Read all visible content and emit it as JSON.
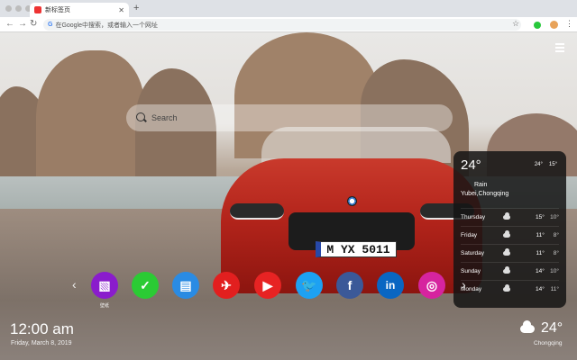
{
  "tab": {
    "title": "新标签页",
    "close_icon": "close-icon",
    "favicon": "app-favicon"
  },
  "omnibox": {
    "placeholder": "在Google中搜索，或者输入一个网址",
    "engine_icon": "G"
  },
  "search": {
    "placeholder": "Search"
  },
  "weather_panel": {
    "temp": "24°",
    "high": "24°",
    "low": "15°",
    "condition": "Rain",
    "location": "Yubei,Chongqing",
    "forecast": [
      {
        "day": "Thursday",
        "hi": "15°",
        "lo": "10°",
        "icon": "cloud-icon"
      },
      {
        "day": "Friday",
        "hi": "11°",
        "lo": "8°",
        "icon": "cloud-icon"
      },
      {
        "day": "Saturday",
        "hi": "11°",
        "lo": "8°",
        "icon": "cloud-icon"
      },
      {
        "day": "Sunday",
        "hi": "14°",
        "lo": "10°",
        "icon": "cloud-icon"
      },
      {
        "day": "Monday",
        "hi": "14°",
        "lo": "11°",
        "icon": "cloud-icon"
      }
    ]
  },
  "apps": [
    {
      "name": "gallery-app",
      "color": "#8a1ccc",
      "glyph": "▧",
      "label": "壁纸"
    },
    {
      "name": "wechat-app",
      "color": "#2bcb34",
      "glyph": "✓"
    },
    {
      "name": "notes-app",
      "color": "#2a8be3",
      "glyph": "▤"
    },
    {
      "name": "red-app",
      "color": "#e21f1f",
      "glyph": "✈"
    },
    {
      "name": "youtube-app",
      "color": "#e72323",
      "glyph": "▶"
    },
    {
      "name": "twitter-app",
      "color": "#1da1f2",
      "glyph": "🐦"
    },
    {
      "name": "facebook-app",
      "color": "#3b5998",
      "glyph": "f"
    },
    {
      "name": "linkedin-app",
      "color": "#0a66c2",
      "glyph": "in"
    },
    {
      "name": "instagram-app",
      "color": "#d6249f",
      "glyph": "◎"
    }
  ],
  "car": {
    "plate": "M YX 5011"
  },
  "clock": {
    "time": "12:00 am",
    "date": "Friday, March 8, 2019"
  },
  "bottom_weather": {
    "temp": "24°",
    "location": "Chongqing"
  }
}
